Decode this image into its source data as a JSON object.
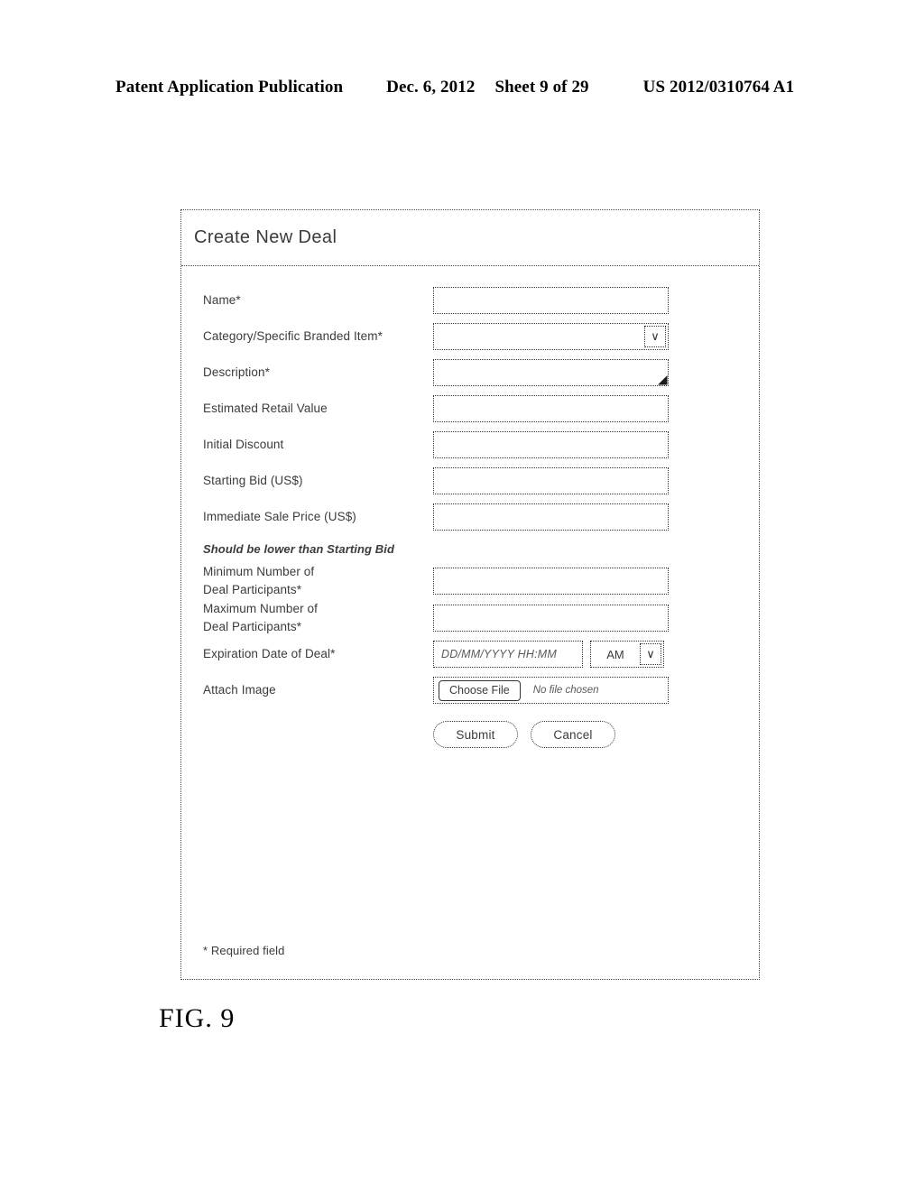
{
  "patent_header": {
    "publication": "Patent Application Publication",
    "date": "Dec. 6, 2012",
    "sheet": "Sheet 9 of 29",
    "number": "US 2012/0310764 A1"
  },
  "figure": {
    "caption": "FIG. 9"
  },
  "panel": {
    "title": "Create New Deal",
    "required_note": "* Required field"
  },
  "fields": {
    "name": {
      "label": "Name*",
      "value": "",
      "placeholder": ""
    },
    "category": {
      "label": "Category/Specific Branded Item*",
      "value": "",
      "chevron": "chevron-down-icon",
      "chevron_glyph": "∨"
    },
    "description": {
      "label": "Description*",
      "value": "",
      "placeholder": ""
    },
    "estimated_retail_value": {
      "label": "Estimated Retail Value",
      "value": ""
    },
    "initial_discount": {
      "label": "Initial Discount",
      "value": ""
    },
    "starting_bid": {
      "label": "Starting Bid (US$)",
      "value": ""
    },
    "immediate_sale_price": {
      "label": "Immediate Sale Price (US$)",
      "value": "",
      "hint": "Should be lower than Starting Bid"
    },
    "min_participants": {
      "label_line1": "Minimum Number of",
      "label_line2": "Deal Participants*",
      "value": ""
    },
    "max_participants": {
      "label_line1": "Maximum Number of",
      "label_line2": "Deal Participants*",
      "value": ""
    },
    "expiration_date": {
      "label": "Expiration Date of Deal*",
      "placeholder": "DD/MM/YYYY HH:MM",
      "value": "",
      "ampm_selected": "AM",
      "ampm_chevron_glyph": "∨"
    },
    "attach_image": {
      "label": "Attach Image",
      "button_label": "Choose File",
      "status_text": "No file chosen"
    }
  },
  "buttons": {
    "submit": "Submit",
    "cancel": "Cancel"
  },
  "colors": {
    "ink": "#000000",
    "wire_border": "#333333",
    "label_text": "#3b3b3b",
    "placeholder_text": "#5a5a5a",
    "background": "#ffffff"
  }
}
